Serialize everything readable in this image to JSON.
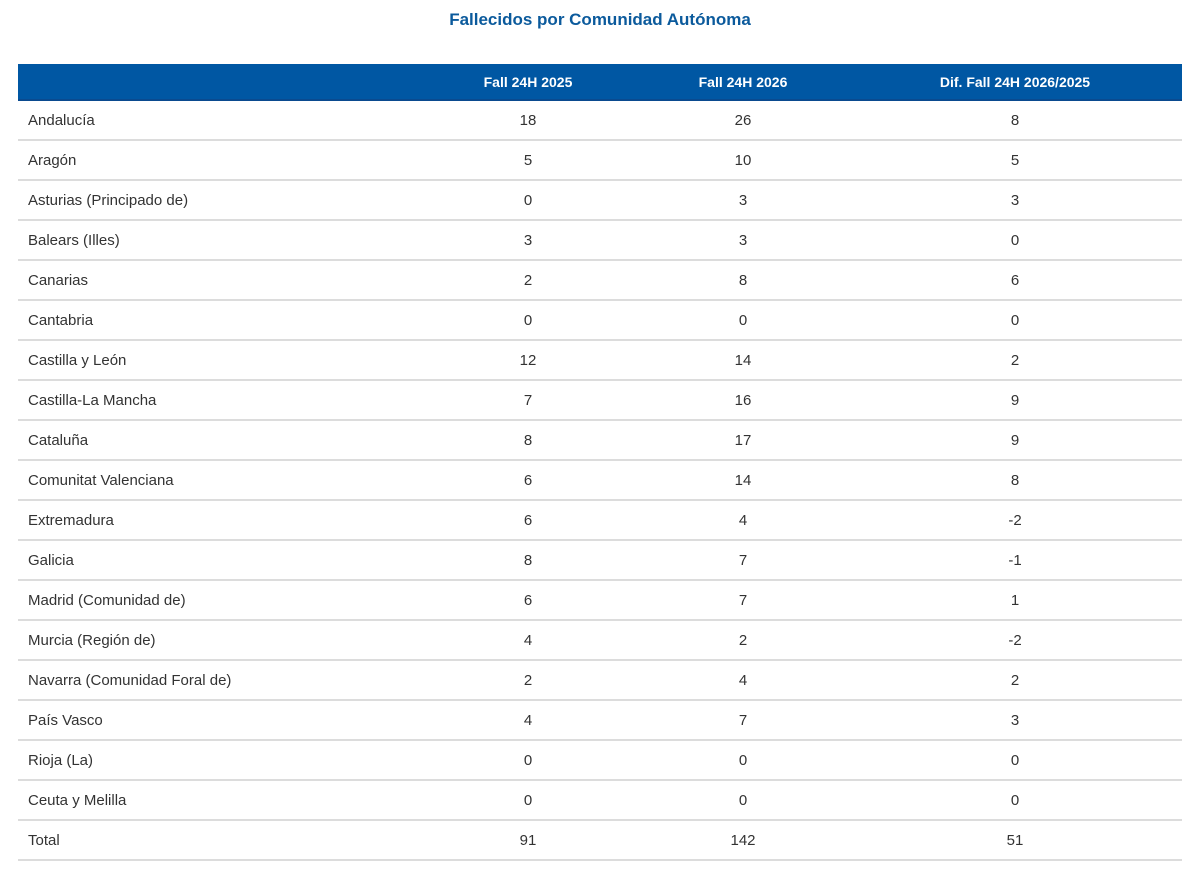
{
  "colors": {
    "header_bg": "#0057A3",
    "title": "#0B5A9C",
    "row_border": "#DCDCDC",
    "text": "#333333"
  },
  "chart_data": {
    "type": "table",
    "title": "Fallecidos por Comunidad Autónoma",
    "columns": [
      "",
      "Fall 24H 2025",
      "Fall 24H 2026",
      "Dif. Fall 24H 2026/2025"
    ],
    "rows": [
      {
        "name": "Andalucía",
        "v2025": "18",
        "v2026": "26",
        "dif": "8"
      },
      {
        "name": "Aragón",
        "v2025": "5",
        "v2026": "10",
        "dif": "5"
      },
      {
        "name": "Asturias (Principado de)",
        "v2025": "0",
        "v2026": "3",
        "dif": "3"
      },
      {
        "name": "Balears (Illes)",
        "v2025": "3",
        "v2026": "3",
        "dif": "0"
      },
      {
        "name": "Canarias",
        "v2025": "2",
        "v2026": "8",
        "dif": "6"
      },
      {
        "name": "Cantabria",
        "v2025": "0",
        "v2026": "0",
        "dif": "0"
      },
      {
        "name": "Castilla y León",
        "v2025": "12",
        "v2026": "14",
        "dif": "2"
      },
      {
        "name": "Castilla-La Mancha",
        "v2025": "7",
        "v2026": "16",
        "dif": "9"
      },
      {
        "name": "Cataluña",
        "v2025": "8",
        "v2026": "17",
        "dif": "9"
      },
      {
        "name": "Comunitat Valenciana",
        "v2025": "6",
        "v2026": "14",
        "dif": "8"
      },
      {
        "name": "Extremadura",
        "v2025": "6",
        "v2026": "4",
        "dif": "-2"
      },
      {
        "name": "Galicia",
        "v2025": "8",
        "v2026": "7",
        "dif": "-1"
      },
      {
        "name": "Madrid (Comunidad de)",
        "v2025": "6",
        "v2026": "7",
        "dif": "1"
      },
      {
        "name": "Murcia (Región de)",
        "v2025": "4",
        "v2026": "2",
        "dif": "-2"
      },
      {
        "name": "Navarra (Comunidad Foral de)",
        "v2025": "2",
        "v2026": "4",
        "dif": "2"
      },
      {
        "name": "País Vasco",
        "v2025": "4",
        "v2026": "7",
        "dif": "3"
      },
      {
        "name": "Rioja (La)",
        "v2025": "0",
        "v2026": "0",
        "dif": "0"
      },
      {
        "name": "Ceuta y Melilla",
        "v2025": "0",
        "v2026": "0",
        "dif": "0"
      },
      {
        "name": "Total",
        "v2025": "91",
        "v2026": "142",
        "dif": "51"
      }
    ]
  }
}
